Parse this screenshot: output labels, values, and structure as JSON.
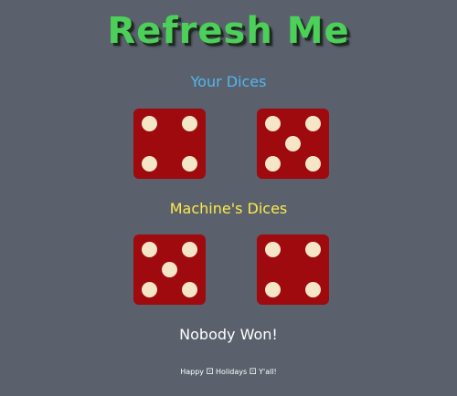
{
  "title": "Refresh Me",
  "player": {
    "label": "Your Dices",
    "dice": [
      4,
      5
    ]
  },
  "machine": {
    "label": "Machine's Dices",
    "dice": [
      5,
      4
    ]
  },
  "result": "Nobody Won!",
  "footer": {
    "word1": "Happy",
    "glyph1": "⚀",
    "word2": "Holidays",
    "glyph2": "⚀",
    "word3": "Y'all!"
  },
  "colors": {
    "background": "#5a616d",
    "title": "#4cd05a",
    "player_label": "#52b7ee",
    "machine_label": "#ffe94a",
    "die_face": "#9e0a0e",
    "pip": "#f6e6c8"
  }
}
